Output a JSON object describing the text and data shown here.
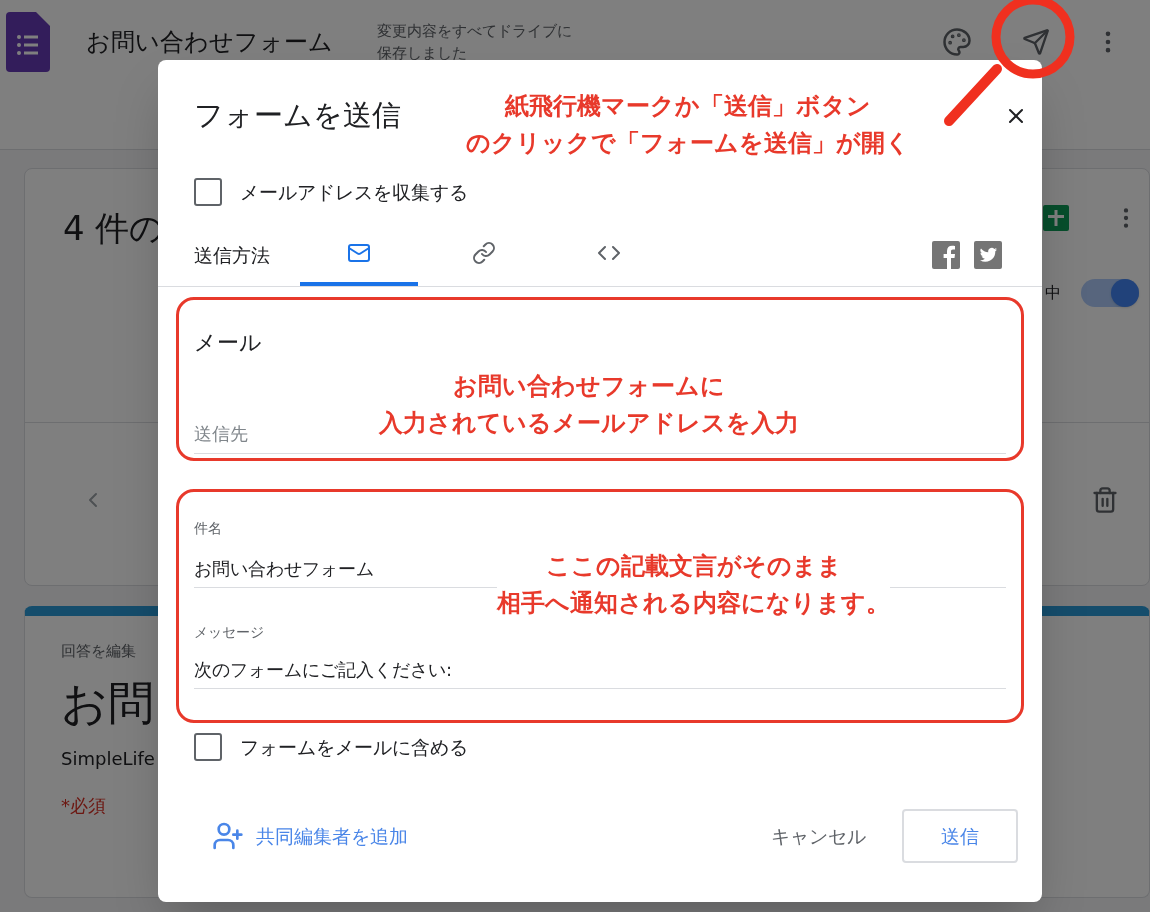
{
  "app_header": {
    "title": "お問い合わせフォーム",
    "save_status": "変更内容をすべてドライブに保存しました"
  },
  "background": {
    "responses_title": "4 件の",
    "toggle_label": "中",
    "toggle_on": true,
    "form_card": {
      "note": "回答を編集",
      "title": "お問",
      "description": "SimpleLife",
      "required_note": "*必須"
    }
  },
  "dialog": {
    "title": "フォームを送信",
    "collect_emails": {
      "label": "メールアドレスを収集する",
      "checked": false
    },
    "send_via_label": "送信方法",
    "tabs": [
      {
        "kind": "mail",
        "selected": true
      },
      {
        "kind": "link",
        "selected": false
      },
      {
        "kind": "embed",
        "selected": false
      }
    ],
    "email_heading": "メール",
    "to_field": {
      "placeholder": "送信先"
    },
    "subject": {
      "label": "件名",
      "value": "お問い合わせフォーム"
    },
    "message": {
      "label": "メッセージ",
      "value": "次のフォームにご記入ください:"
    },
    "include_form": {
      "label": "フォームをメールに含める",
      "checked": false
    },
    "add_collaborators": "共同編集者を追加",
    "cancel": "キャンセル",
    "send": "送信"
  },
  "annotations": [
    {
      "lines": [
        "紙飛行機マークか「送信」ボタン",
        "のクリックで「フォームを送信」が開く"
      ]
    },
    {
      "lines": [
        "お問い合わせフォームに",
        "入力されているメールアドレスを入力"
      ]
    },
    {
      "lines": [
        "ここの記載文言がそのまま",
        "相手へ通知される内容になります。"
      ]
    }
  ]
}
